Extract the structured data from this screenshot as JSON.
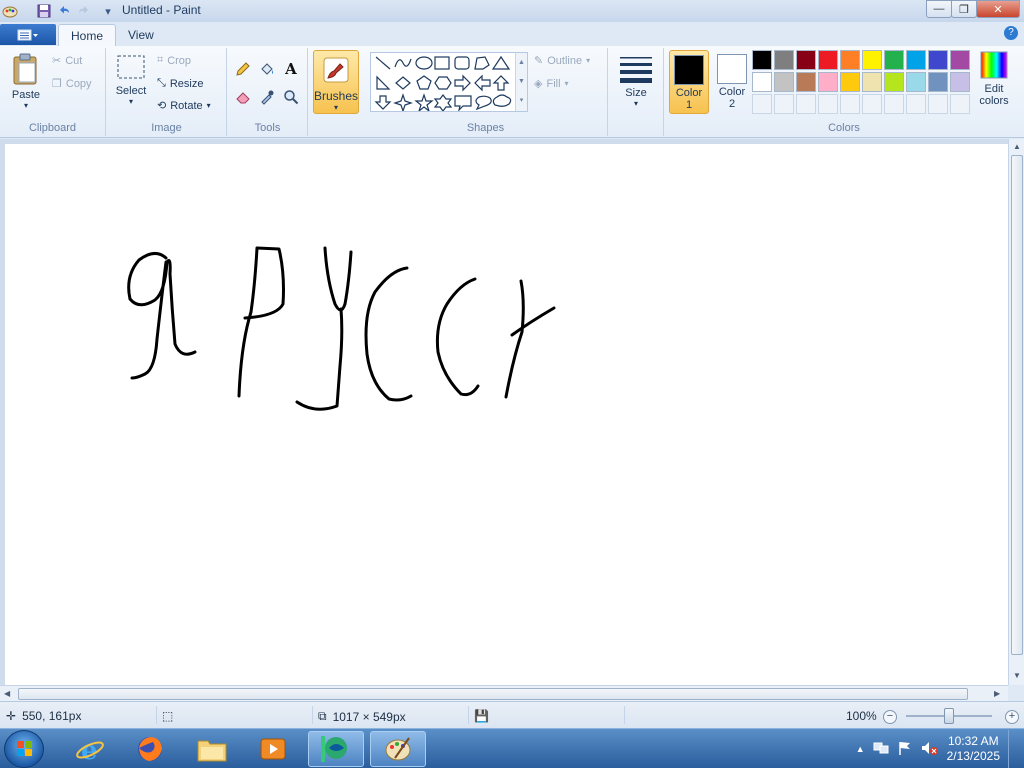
{
  "window": {
    "title": "Untitled - Paint",
    "minimize": "—",
    "maximize": "❐",
    "close": "✕"
  },
  "quick_access": {
    "menu_arrow": "▾"
  },
  "tabs": [
    {
      "label": "Home",
      "active": true
    },
    {
      "label": "View",
      "active": false
    }
  ],
  "help_glyph": "?",
  "groups": {
    "clipboard": {
      "label": "Clipboard",
      "paste": "Paste",
      "cut": "Cut",
      "copy": "Copy"
    },
    "image": {
      "label": "Image",
      "select": "Select",
      "crop": "Crop",
      "resize": "Resize",
      "rotate": "Rotate"
    },
    "tools": {
      "label": "Tools",
      "text_glyph": "A"
    },
    "brushes": {
      "label": "Brushes"
    },
    "shapes": {
      "label": "Shapes",
      "outline": "Outline",
      "fill": "Fill"
    },
    "size": {
      "label": "Size"
    },
    "colors": {
      "label": "Colors",
      "color1_line1": "Color",
      "color1_line2": "1",
      "color2_line1": "Color",
      "color2_line2": "2",
      "color1_value": "#000000",
      "color2_value": "#ffffff",
      "edit_line1": "Edit",
      "edit_line2": "colors",
      "palette_row1": [
        "#000000",
        "#7f7f7f",
        "#880015",
        "#ed1c24",
        "#ff7f27",
        "#fff200",
        "#22b14c",
        "#00a2e8",
        "#3f48cc",
        "#a349a4"
      ],
      "palette_row2": [
        "#ffffff",
        "#c3c3c3",
        "#b97a57",
        "#ffaec9",
        "#ffc90e",
        "#efe4b0",
        "#b5e61d",
        "#99d9ea",
        "#7092be",
        "#c8bfe7"
      ]
    }
  },
  "status": {
    "cursor_pos": "550, 161px",
    "image_size": "1017 × 549px",
    "zoom": "100%",
    "zoom_minus": "−",
    "zoom_plus": "+"
  },
  "taskbar": {
    "time": "10:32 AM",
    "date": "2/13/2025",
    "tray_arrow": "▲"
  }
}
